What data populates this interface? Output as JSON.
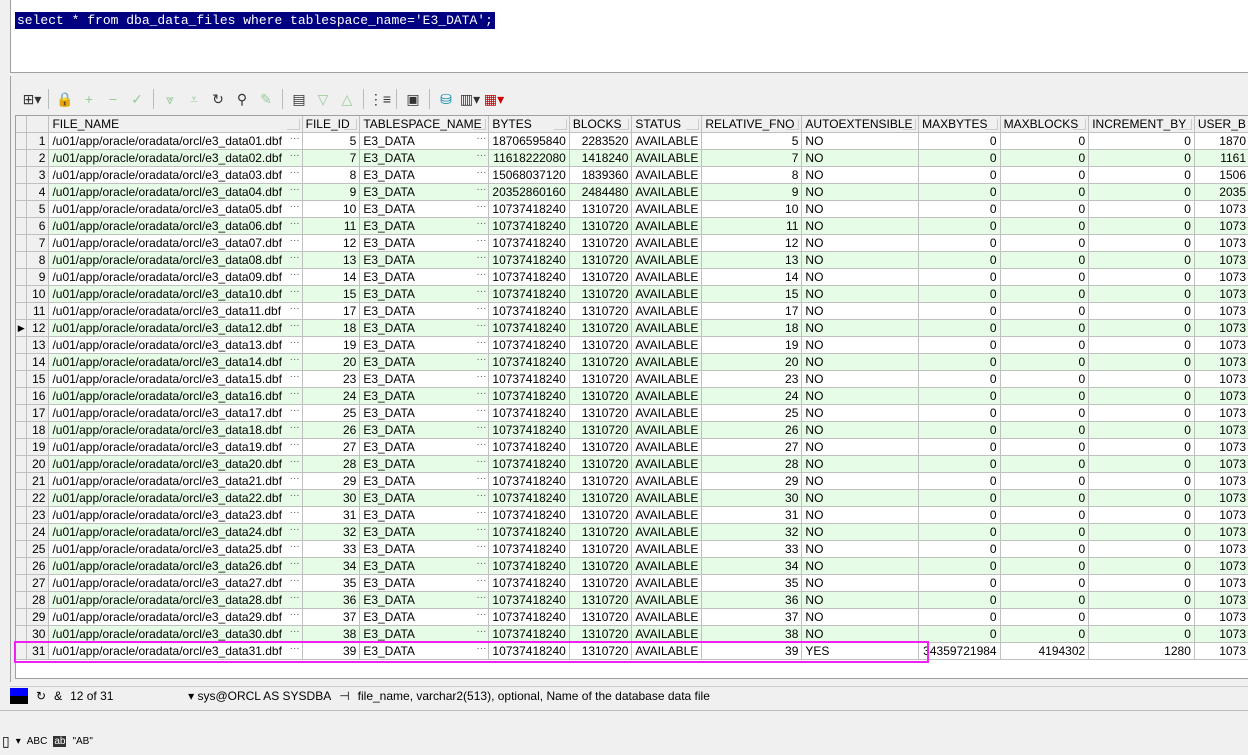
{
  "editor": {
    "sql": "select * from dba_data_files where tablespace_name='E3_DATA';"
  },
  "toolbar": {
    "icons": [
      "grid-options-icon",
      "lock-icon",
      "add-record-icon",
      "delete-record-icon",
      "post-changes-icon",
      "fetch-next-icon",
      "fetch-last-icon",
      "refresh-icon",
      "find-icon",
      "clear-icon",
      "query-by-example-icon",
      "previous-icon",
      "next-icon",
      "single-record-view-icon",
      "save-icon",
      "export-icon",
      "chart-icon",
      "table-icon"
    ]
  },
  "grid": {
    "columns": [
      "FILE_NAME",
      "FILE_ID",
      "TABLESPACE_NAME",
      "BYTES",
      "BLOCKS",
      "STATUS",
      "RELATIVE_FNO",
      "AUTOEXTENSIBLE",
      "MAXBYTES",
      "MAXBLOCKS",
      "INCREMENT_BY",
      "USER_B"
    ],
    "current_row": 12,
    "rows": [
      [
        "/u01/app/oracle/oradata/orcl/e3_data01.dbf",
        "5",
        "E3_DATA",
        "18706595840",
        "2283520",
        "AVAILABLE",
        "5",
        "NO",
        "0",
        "0",
        "0",
        "1870"
      ],
      [
        "/u01/app/oracle/oradata/orcl/e3_data02.dbf",
        "7",
        "E3_DATA",
        "11618222080",
        "1418240",
        "AVAILABLE",
        "7",
        "NO",
        "0",
        "0",
        "0",
        "1161"
      ],
      [
        "/u01/app/oracle/oradata/orcl/e3_data03.dbf",
        "8",
        "E3_DATA",
        "15068037120",
        "1839360",
        "AVAILABLE",
        "8",
        "NO",
        "0",
        "0",
        "0",
        "1506"
      ],
      [
        "/u01/app/oracle/oradata/orcl/e3_data04.dbf",
        "9",
        "E3_DATA",
        "20352860160",
        "2484480",
        "AVAILABLE",
        "9",
        "NO",
        "0",
        "0",
        "0",
        "2035"
      ],
      [
        "/u01/app/oracle/oradata/orcl/e3_data05.dbf",
        "10",
        "E3_DATA",
        "10737418240",
        "1310720",
        "AVAILABLE",
        "10",
        "NO",
        "0",
        "0",
        "0",
        "1073"
      ],
      [
        "/u01/app/oracle/oradata/orcl/e3_data06.dbf",
        "11",
        "E3_DATA",
        "10737418240",
        "1310720",
        "AVAILABLE",
        "11",
        "NO",
        "0",
        "0",
        "0",
        "1073"
      ],
      [
        "/u01/app/oracle/oradata/orcl/e3_data07.dbf",
        "12",
        "E3_DATA",
        "10737418240",
        "1310720",
        "AVAILABLE",
        "12",
        "NO",
        "0",
        "0",
        "0",
        "1073"
      ],
      [
        "/u01/app/oracle/oradata/orcl/e3_data08.dbf",
        "13",
        "E3_DATA",
        "10737418240",
        "1310720",
        "AVAILABLE",
        "13",
        "NO",
        "0",
        "0",
        "0",
        "1073"
      ],
      [
        "/u01/app/oracle/oradata/orcl/e3_data09.dbf",
        "14",
        "E3_DATA",
        "10737418240",
        "1310720",
        "AVAILABLE",
        "14",
        "NO",
        "0",
        "0",
        "0",
        "1073"
      ],
      [
        "/u01/app/oracle/oradata/orcl/e3_data10.dbf",
        "15",
        "E3_DATA",
        "10737418240",
        "1310720",
        "AVAILABLE",
        "15",
        "NO",
        "0",
        "0",
        "0",
        "1073"
      ],
      [
        "/u01/app/oracle/oradata/orcl/e3_data11.dbf",
        "17",
        "E3_DATA",
        "10737418240",
        "1310720",
        "AVAILABLE",
        "17",
        "NO",
        "0",
        "0",
        "0",
        "1073"
      ],
      [
        "/u01/app/oracle/oradata/orcl/e3_data12.dbf",
        "18",
        "E3_DATA",
        "10737418240",
        "1310720",
        "AVAILABLE",
        "18",
        "NO",
        "0",
        "0",
        "0",
        "1073"
      ],
      [
        "/u01/app/oracle/oradata/orcl/e3_data13.dbf",
        "19",
        "E3_DATA",
        "10737418240",
        "1310720",
        "AVAILABLE",
        "19",
        "NO",
        "0",
        "0",
        "0",
        "1073"
      ],
      [
        "/u01/app/oracle/oradata/orcl/e3_data14.dbf",
        "20",
        "E3_DATA",
        "10737418240",
        "1310720",
        "AVAILABLE",
        "20",
        "NO",
        "0",
        "0",
        "0",
        "1073"
      ],
      [
        "/u01/app/oracle/oradata/orcl/e3_data15.dbf",
        "23",
        "E3_DATA",
        "10737418240",
        "1310720",
        "AVAILABLE",
        "23",
        "NO",
        "0",
        "0",
        "0",
        "1073"
      ],
      [
        "/u01/app/oracle/oradata/orcl/e3_data16.dbf",
        "24",
        "E3_DATA",
        "10737418240",
        "1310720",
        "AVAILABLE",
        "24",
        "NO",
        "0",
        "0",
        "0",
        "1073"
      ],
      [
        "/u01/app/oracle/oradata/orcl/e3_data17.dbf",
        "25",
        "E3_DATA",
        "10737418240",
        "1310720",
        "AVAILABLE",
        "25",
        "NO",
        "0",
        "0",
        "0",
        "1073"
      ],
      [
        "/u01/app/oracle/oradata/orcl/e3_data18.dbf",
        "26",
        "E3_DATA",
        "10737418240",
        "1310720",
        "AVAILABLE",
        "26",
        "NO",
        "0",
        "0",
        "0",
        "1073"
      ],
      [
        "/u01/app/oracle/oradata/orcl/e3_data19.dbf",
        "27",
        "E3_DATA",
        "10737418240",
        "1310720",
        "AVAILABLE",
        "27",
        "NO",
        "0",
        "0",
        "0",
        "1073"
      ],
      [
        "/u01/app/oracle/oradata/orcl/e3_data20.dbf",
        "28",
        "E3_DATA",
        "10737418240",
        "1310720",
        "AVAILABLE",
        "28",
        "NO",
        "0",
        "0",
        "0",
        "1073"
      ],
      [
        "/u01/app/oracle/oradata/orcl/e3_data21.dbf",
        "29",
        "E3_DATA",
        "10737418240",
        "1310720",
        "AVAILABLE",
        "29",
        "NO",
        "0",
        "0",
        "0",
        "1073"
      ],
      [
        "/u01/app/oracle/oradata/orcl/e3_data22.dbf",
        "30",
        "E3_DATA",
        "10737418240",
        "1310720",
        "AVAILABLE",
        "30",
        "NO",
        "0",
        "0",
        "0",
        "1073"
      ],
      [
        "/u01/app/oracle/oradata/orcl/e3_data23.dbf",
        "31",
        "E3_DATA",
        "10737418240",
        "1310720",
        "AVAILABLE",
        "31",
        "NO",
        "0",
        "0",
        "0",
        "1073"
      ],
      [
        "/u01/app/oracle/oradata/orcl/e3_data24.dbf",
        "32",
        "E3_DATA",
        "10737418240",
        "1310720",
        "AVAILABLE",
        "32",
        "NO",
        "0",
        "0",
        "0",
        "1073"
      ],
      [
        "/u01/app/oracle/oradata/orcl/e3_data25.dbf",
        "33",
        "E3_DATA",
        "10737418240",
        "1310720",
        "AVAILABLE",
        "33",
        "NO",
        "0",
        "0",
        "0",
        "1073"
      ],
      [
        "/u01/app/oracle/oradata/orcl/e3_data26.dbf",
        "34",
        "E3_DATA",
        "10737418240",
        "1310720",
        "AVAILABLE",
        "34",
        "NO",
        "0",
        "0",
        "0",
        "1073"
      ],
      [
        "/u01/app/oracle/oradata/orcl/e3_data27.dbf",
        "35",
        "E3_DATA",
        "10737418240",
        "1310720",
        "AVAILABLE",
        "35",
        "NO",
        "0",
        "0",
        "0",
        "1073"
      ],
      [
        "/u01/app/oracle/oradata/orcl/e3_data28.dbf",
        "36",
        "E3_DATA",
        "10737418240",
        "1310720",
        "AVAILABLE",
        "36",
        "NO",
        "0",
        "0",
        "0",
        "1073"
      ],
      [
        "/u01/app/oracle/oradata/orcl/e3_data29.dbf",
        "37",
        "E3_DATA",
        "10737418240",
        "1310720",
        "AVAILABLE",
        "37",
        "NO",
        "0",
        "0",
        "0",
        "1073"
      ],
      [
        "/u01/app/oracle/oradata/orcl/e3_data30.dbf",
        "38",
        "E3_DATA",
        "10737418240",
        "1310720",
        "AVAILABLE",
        "38",
        "NO",
        "0",
        "0",
        "0",
        "1073"
      ],
      [
        "/u01/app/oracle/oradata/orcl/e3_data31.dbf",
        "39",
        "E3_DATA",
        "10737418240",
        "1310720",
        "AVAILABLE",
        "39",
        "YES",
        "34359721984",
        "4194302",
        "1280",
        "1073"
      ]
    ],
    "highlight_color": "#f020f0"
  },
  "status": {
    "record": "12 of 31",
    "connection": "sys@ORCL AS SYSDBA",
    "column_info": "file_name, varchar2(513), optional, Name of the database data file"
  },
  "bottom": {
    "abc": "ABC",
    "ab": "\"AB\""
  }
}
